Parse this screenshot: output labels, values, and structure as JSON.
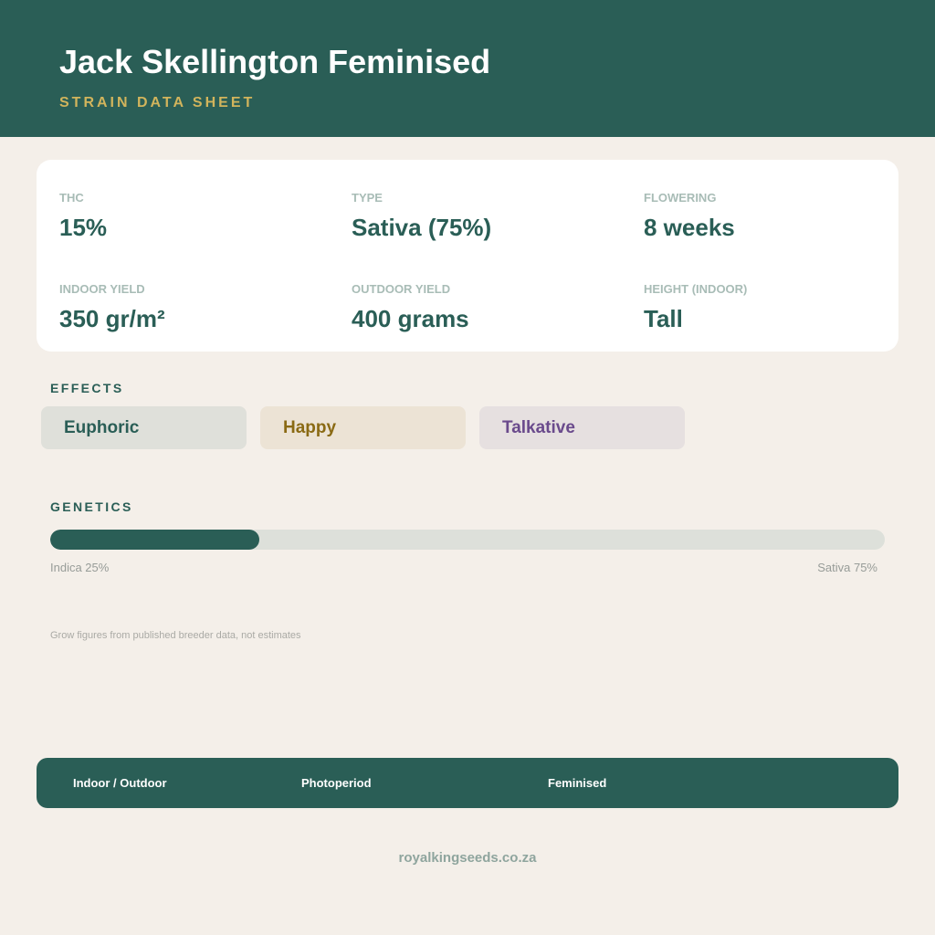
{
  "header": {
    "title": "Jack Skellington Feminised",
    "subtitle": "STRAIN DATA SHEET"
  },
  "stats": [
    {
      "label": "THC",
      "value": "15%"
    },
    {
      "label": "TYPE",
      "value": "Sativa (75%)"
    },
    {
      "label": "FLOWERING",
      "value": "8 weeks"
    },
    {
      "label": "INDOOR YIELD",
      "value": "350 gr/m²"
    },
    {
      "label": "OUTDOOR YIELD",
      "value": "400 grams"
    },
    {
      "label": "HEIGHT (INDOOR)",
      "value": "Tall"
    }
  ],
  "effects": {
    "label": "EFFECTS",
    "items": [
      {
        "label": "Euphoric",
        "text_color": "#2a5e56",
        "bg_color": "#dfe0da"
      },
      {
        "label": "Happy",
        "text_color": "#8a6a14",
        "bg_color": "#ece3d5"
      },
      {
        "label": "Talkative",
        "text_color": "#6a4a8c",
        "bg_color": "#e6e0e0"
      }
    ]
  },
  "genetics": {
    "label": "GENETICS",
    "indica_percent": 25,
    "sativa_percent": 75,
    "indica_label": "Indica 25%",
    "sativa_label": "Sativa 75%"
  },
  "note": "Grow figures from published breeder data, not estimates",
  "footer": {
    "items": [
      "Indoor / Outdoor",
      "Photoperiod",
      "Feminised"
    ]
  },
  "website": "royalkingseeds.co.za",
  "colors": {
    "brand_green": "#2a5e56",
    "accent_gold": "#d1b45c",
    "background": "#f4efe9"
  }
}
